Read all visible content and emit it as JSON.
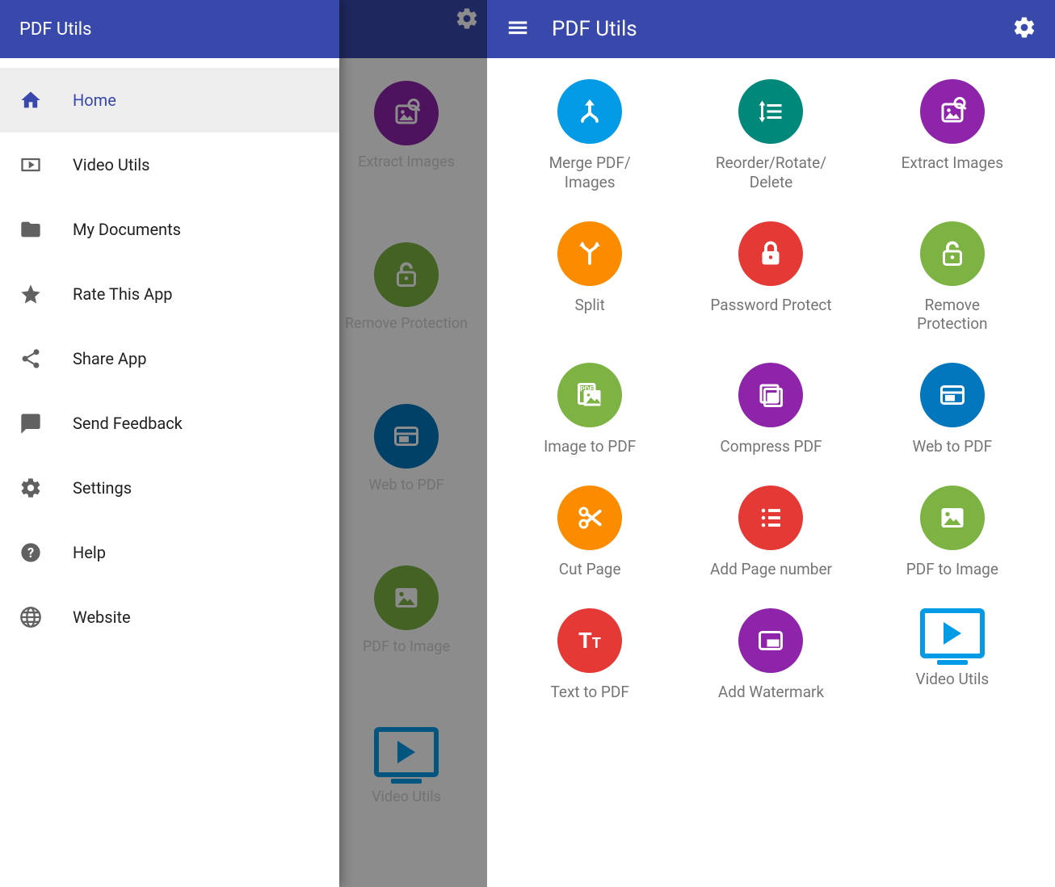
{
  "colors": {
    "primary": "#3949ab",
    "cyan": "#039be5",
    "teal": "#00897b",
    "purple": "#8e24aa",
    "orange": "#fb8c00",
    "red": "#e53935",
    "green": "#7cb342",
    "blue": "#0277bd"
  },
  "leftScreen": {
    "drawerTitle": "PDF Utils",
    "menu": [
      {
        "label": "Home",
        "icon": "home-icon",
        "active": true
      },
      {
        "label": "Video Utils",
        "icon": "video-icon",
        "active": false
      },
      {
        "label": "My Documents",
        "icon": "folder-icon",
        "active": false
      },
      {
        "label": "Rate This App",
        "icon": "star-icon",
        "active": false
      },
      {
        "label": "Share App",
        "icon": "share-icon",
        "active": false
      },
      {
        "label": "Send Feedback",
        "icon": "feedback-icon",
        "active": false
      },
      {
        "label": "Settings",
        "icon": "gear-icon",
        "active": false
      },
      {
        "label": "Help",
        "icon": "help-icon",
        "active": false
      },
      {
        "label": "Website",
        "icon": "globe-icon",
        "active": false
      }
    ],
    "backgroundPartialTools": [
      {
        "label": "Extract Images",
        "colorClass": "c-purple",
        "icon": "extract-images-icon"
      },
      {
        "label": "Remove\nProtection",
        "colorClass": "c-green",
        "icon": "unlock-icon"
      },
      {
        "label": "Web to PDF",
        "colorClass": "c-blue",
        "icon": "web-icon"
      },
      {
        "label": "PDF to Image",
        "colorClass": "c-green",
        "icon": "image-icon"
      },
      {
        "label": "Video Utils",
        "colorClass": "",
        "icon": "video-tile-icon"
      }
    ]
  },
  "rightScreen": {
    "title": "PDF Utils",
    "tools": [
      {
        "label": "Merge PDF/\nImages",
        "colorClass": "c-cyan",
        "icon": "merge-icon"
      },
      {
        "label": "Reorder/Rotate/\nDelete",
        "colorClass": "c-teal",
        "icon": "reorder-icon"
      },
      {
        "label": "Extract Images",
        "colorClass": "c-purple",
        "icon": "extract-images-icon"
      },
      {
        "label": "Split",
        "colorClass": "c-orange",
        "icon": "split-icon"
      },
      {
        "label": "Password Protect",
        "colorClass": "c-red",
        "icon": "lock-icon"
      },
      {
        "label": "Remove\nProtection",
        "colorClass": "c-green",
        "icon": "unlock-icon"
      },
      {
        "label": "Image to PDF",
        "colorClass": "c-green",
        "icon": "image-to-pdf-icon"
      },
      {
        "label": "Compress PDF",
        "colorClass": "c-purple",
        "icon": "compress-icon"
      },
      {
        "label": "Web to PDF",
        "colorClass": "c-blue",
        "icon": "web-icon"
      },
      {
        "label": "Cut Page",
        "colorClass": "c-orange",
        "icon": "cut-icon"
      },
      {
        "label": "Add Page number",
        "colorClass": "c-red",
        "icon": "page-number-icon"
      },
      {
        "label": "PDF to Image",
        "colorClass": "c-green",
        "icon": "image-icon"
      },
      {
        "label": "Text to PDF",
        "colorClass": "c-red",
        "icon": "text-icon"
      },
      {
        "label": "Add Watermark",
        "colorClass": "c-purple",
        "icon": "watermark-icon"
      },
      {
        "label": "Video Utils",
        "colorClass": "",
        "icon": "video-tile-icon"
      }
    ]
  }
}
